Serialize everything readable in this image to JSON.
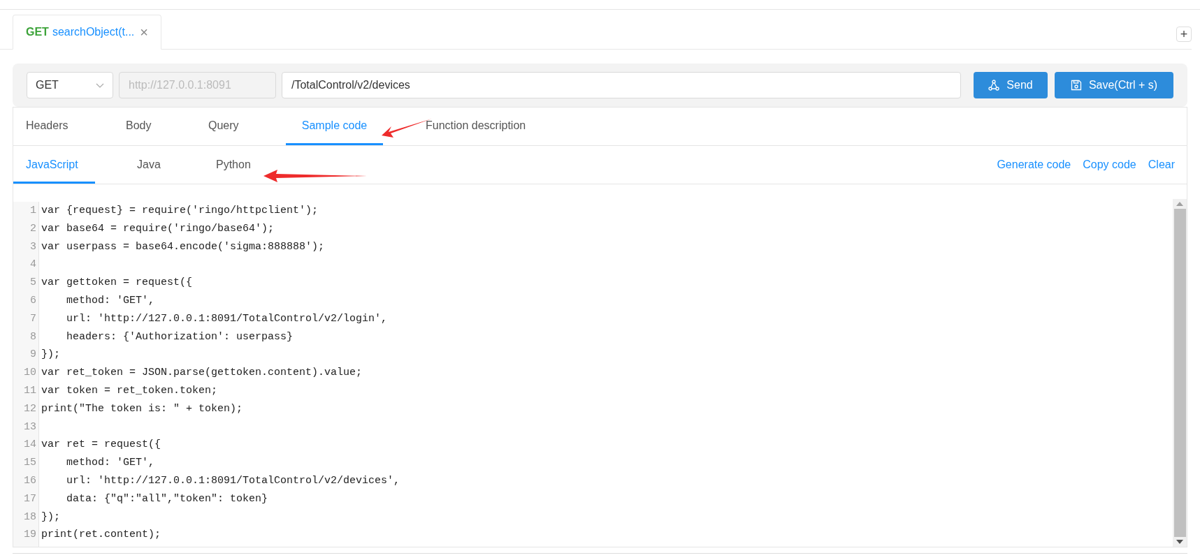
{
  "open_tabs": [
    {
      "method": "GET",
      "title": "searchObject(t...",
      "close": "×",
      "selected": true
    }
  ],
  "add_tab": "+",
  "request_bar": {
    "method": "GET",
    "base_url": "http://127.0.0.1:8091",
    "path": "/TotalControl/v2/devices",
    "send": "Send",
    "save": "Save(Ctrl + s)"
  },
  "tabs": [
    {
      "label": "Headers",
      "selected": false
    },
    {
      "label": "Body",
      "selected": false
    },
    {
      "label": "Query",
      "selected": false
    },
    {
      "label": "Sample code",
      "selected": true
    },
    {
      "label": "Function description",
      "selected": false
    }
  ],
  "language_tabs": [
    {
      "label": "JavaScript",
      "selected": true
    },
    {
      "label": "Java",
      "selected": false
    },
    {
      "label": "Python",
      "selected": false
    }
  ],
  "actions": [
    "Generate code",
    "Copy code",
    "Clear"
  ],
  "code_lines": [
    {
      "number": "1",
      "code": "var {request} = require('ringo/httpclient');"
    },
    {
      "number": "2",
      "code": "var base64 = require('ringo/base64');"
    },
    {
      "number": "3",
      "code": "var userpass = base64.encode('sigma:888888');"
    },
    {
      "number": "4"
    },
    {
      "number": "5",
      "code": "var gettoken = request({"
    },
    {
      "number": "6",
      "code": "    method: 'GET',"
    },
    {
      "number": "7",
      "code": "    url: 'http://127.0.0.1:8091/TotalControl/v2/login',"
    },
    {
      "number": "8",
      "code": "    headers: {'Authorization': userpass}"
    },
    {
      "number": "9",
      "code": "});"
    },
    {
      "number": "10",
      "code": "var ret_token = JSON.parse(gettoken.content).value;"
    },
    {
      "number": "11",
      "code": "var token = ret_token.token;"
    },
    {
      "number": "12",
      "code": "print(\"The token is: \" + token);"
    },
    {
      "number": "13"
    },
    {
      "number": "14",
      "code": "var ret = request({"
    },
    {
      "number": "15",
      "code": "    method: 'GET',"
    },
    {
      "number": "16",
      "code": "    url: 'http://127.0.0.1:8091/TotalControl/v2/devices',"
    },
    {
      "number": "17",
      "code": "    data: {\"q\":\"all\",\"token\": token}"
    },
    {
      "number": "18",
      "code": "});"
    },
    {
      "number": "19",
      "code": "print(ret.content);"
    }
  ]
}
